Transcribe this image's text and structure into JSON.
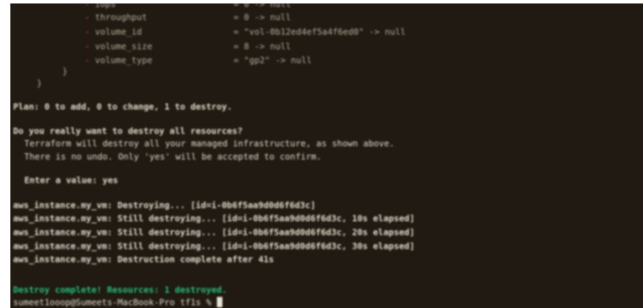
{
  "terminal": {
    "attrs": [
      {
        "minus": "-",
        "name": "iops",
        "value": "= 0 -> null"
      },
      {
        "minus": "-",
        "name": "throughput",
        "value": "= 0 -> null"
      },
      {
        "minus": "-",
        "name": "volume_id",
        "value": "= \"vol-0b12ed4ef5a4f6ed0\" -> null"
      },
      {
        "minus": "-",
        "name": "volume_size",
        "value": "= 8 -> null"
      },
      {
        "minus": "-",
        "name": "volume_type",
        "value": "= \"gp2\" -> null"
      }
    ],
    "close_inner": "}",
    "close_outer": "}",
    "plan": "Plan: 0 to add, 0 to change, 1 to destroy.",
    "question": "Do you really want to destroy all resources?",
    "warn1": "Terraform will destroy all your managed infrastructure, as shown above.",
    "warn2": "There is no undo. Only 'yes' will be accepted to confirm.",
    "enter_value": "Enter a value: yes",
    "destroy_lines": [
      "aws_instance.my_vm: Destroying... [id=i-0b6f5aa9d0d6f6d3c]",
      "aws_instance.my_vm: Still destroying... [id=i-0b6f5aa9d0d6f6d3c, 10s elapsed]",
      "aws_instance.my_vm: Still destroying... [id=i-0b6f5aa9d0d6f6d3c, 20s elapsed]",
      "aws_instance.my_vm: Still destroying... [id=i-0b6f5aa9d0d6f6d3c, 30s elapsed]",
      "aws_instance.my_vm: Destruction complete after 41s"
    ],
    "complete": "Destroy complete! Resources: 1 destroyed.",
    "prompt": "sumeet1ooop@Sumeets-MacBook-Pro tf1s % "
  }
}
